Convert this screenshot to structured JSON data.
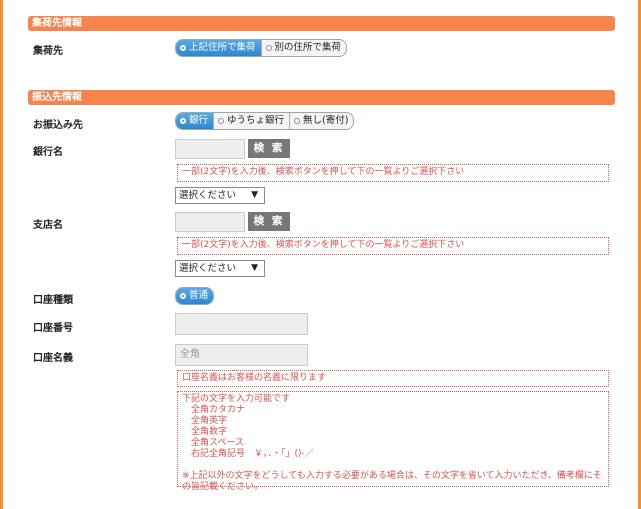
{
  "colors": {
    "section_header": "#f7834d",
    "selected": "#2f86cc",
    "note_text": "#d9534f",
    "border": "#f0932b"
  },
  "pickup": {
    "header": "集荷先情報",
    "label": "集荷先",
    "options": [
      "上記住所で集荷",
      "別の住所で集荷"
    ],
    "selected": "上記住所で集荷"
  },
  "transfer": {
    "header": "振込先情報",
    "method_label": "お振込み先",
    "method_options": [
      "銀行",
      "ゆうちょ銀行",
      "無し(寄付)"
    ],
    "method_selected": "銀行",
    "bank_label": "銀行名",
    "bank_search": "検 索",
    "bank_note": "一部(2文字)を入力後、検索ボタンを押して下の一覧よりご選択下さい",
    "bank_select": "選択ください",
    "branch_label": "支店名",
    "branch_search": "検 索",
    "branch_note": "一部(2文字)を入力後、検索ボタンを押して下の一覧よりご選択下さい",
    "branch_select": "選択ください",
    "account_type_label": "口座種類",
    "account_type_option": "普通",
    "account_number_label": "口座番号",
    "account_name_label": "口座名義",
    "account_name_placeholder": "全角",
    "account_name_note": "口座名義はお客様の名義に限ります",
    "chars_note": "下記の文字を入力可能です\n　全角カタカナ\n　全角英字\n　全角数字\n　全角スペース\n　右記全角記号　￥，．・「」()-／\n\n※上記以外の文字をどうしても入力する必要がある場合は、その文字を省いて入力いただき、備考欄にその旨記載ください。"
  }
}
